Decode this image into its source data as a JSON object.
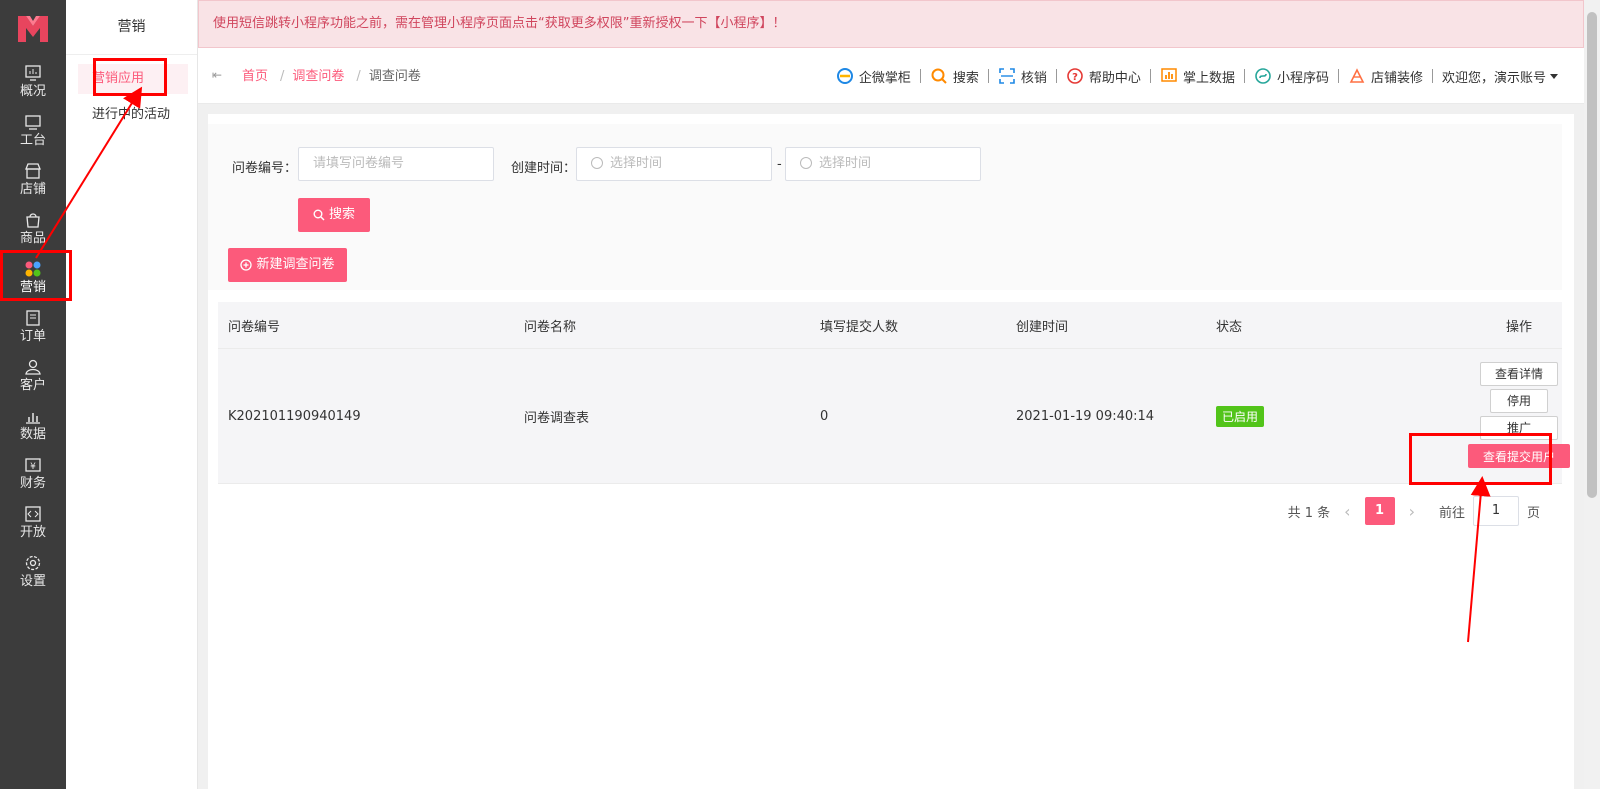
{
  "notice": {
    "text": "使用短信跳转小程序功能之前，需在管理小程序页面点击“获取更多权限”重新授权一下【小程序】！"
  },
  "leftnav": {
    "items": [
      {
        "label": "概况",
        "icon": "dashboard-icon"
      },
      {
        "label": "工台",
        "icon": "monitor-icon"
      },
      {
        "label": "店铺",
        "icon": "store-icon"
      },
      {
        "label": "商品",
        "icon": "bag-icon"
      },
      {
        "label": "营销",
        "icon": "marketing-icon",
        "active": true
      },
      {
        "label": "订单",
        "icon": "order-icon"
      },
      {
        "label": "客户",
        "icon": "user-icon"
      },
      {
        "label": "数据",
        "icon": "chart-icon"
      },
      {
        "label": "财务",
        "icon": "finance-icon"
      },
      {
        "label": "开放",
        "icon": "code-icon"
      },
      {
        "label": "设置",
        "icon": "gear-icon"
      }
    ]
  },
  "submenu": {
    "title": "营销",
    "items": [
      {
        "label": "营销应用",
        "active": true
      },
      {
        "label": "进行中的活动"
      }
    ]
  },
  "header": {
    "breadcrumb": [
      "首页",
      "调查问卷",
      "调查问卷"
    ],
    "toolbar": [
      "企微掌柜",
      "搜索",
      "核销",
      "帮助中心",
      "掌上数据",
      "小程序码",
      "店铺装修"
    ],
    "user": "欢迎您，演示账号"
  },
  "filter": {
    "id_label": "问卷编号：",
    "id_placeholder": "请填写问卷编号",
    "time_label": "创建时间：",
    "time_start_placeholder": "选择时间",
    "time_end_placeholder": "选择时间",
    "dash": "-",
    "search_btn": "搜索",
    "new_btn": "新建调查问卷"
  },
  "table": {
    "headers": [
      "问卷编号",
      "问卷名称",
      "填写提交人数",
      "创建时间",
      "状态",
      "操作"
    ],
    "rows": [
      {
        "id": "K202101190940149",
        "name": "问卷调查表",
        "count": "0",
        "created": "2021-01-19 09:40:14",
        "status": "已启用",
        "ops": [
          "查看详情",
          "停用",
          "推广",
          "查看提交用户"
        ]
      }
    ]
  },
  "pagination": {
    "total": "共 1 条",
    "current": "1",
    "goto_label": "前往",
    "goto_value": "1",
    "page_suffix": "页"
  },
  "colors": {
    "accent": "#fc5a7b",
    "nav_bg": "#3c3c3c",
    "status_green": "#52c41a",
    "annotation": "#ff0000"
  }
}
